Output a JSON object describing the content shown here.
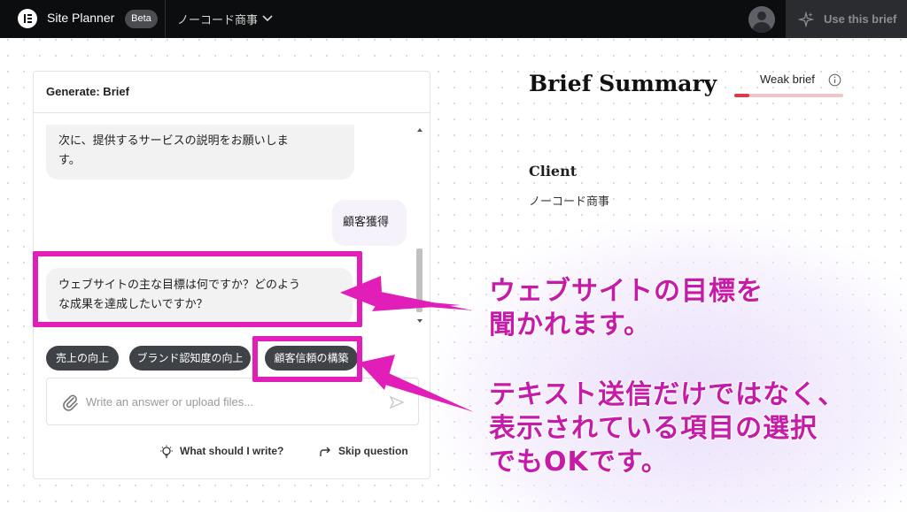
{
  "topbar": {
    "app_title": "Site Planner",
    "badge": "Beta",
    "project_name": "ノーコード商事",
    "use_brief_label": "Use this brief"
  },
  "chat": {
    "header": "Generate: Brief",
    "messages": [
      {
        "role": "assistant",
        "text": "次に、提供するサービスの説明をお願いしま\nす。"
      },
      {
        "role": "user",
        "text": "顧客獲得"
      },
      {
        "role": "assistant",
        "text": "ウェブサイトの主な目標は何ですか？どのよう\nな成果を達成したいですか？"
      }
    ],
    "suggestions": [
      "売上の向上",
      "ブランド認知度の向上",
      "顧客信頼の構築"
    ],
    "input_placeholder": "Write an answer or upload files...",
    "what_should_i_write": "What should I write?",
    "skip_question": "Skip question"
  },
  "summary": {
    "title": "Brief Summary",
    "strength_label": "Weak brief",
    "strength_fraction": 0.14,
    "client_label": "Client",
    "client_value": "ノーコード商事"
  },
  "annotations": {
    "note1": "ウェブサイトの目標を\n聞かれます。",
    "note2": "テキスト送信だけではなく、\n表示されている項目の選択\nでもOKです。"
  },
  "colors": {
    "topbar": "#0c0d0e",
    "highlight": "#e11fb8",
    "annotation_text": "#c61aa8",
    "strength_fill": "#d93b4a"
  }
}
